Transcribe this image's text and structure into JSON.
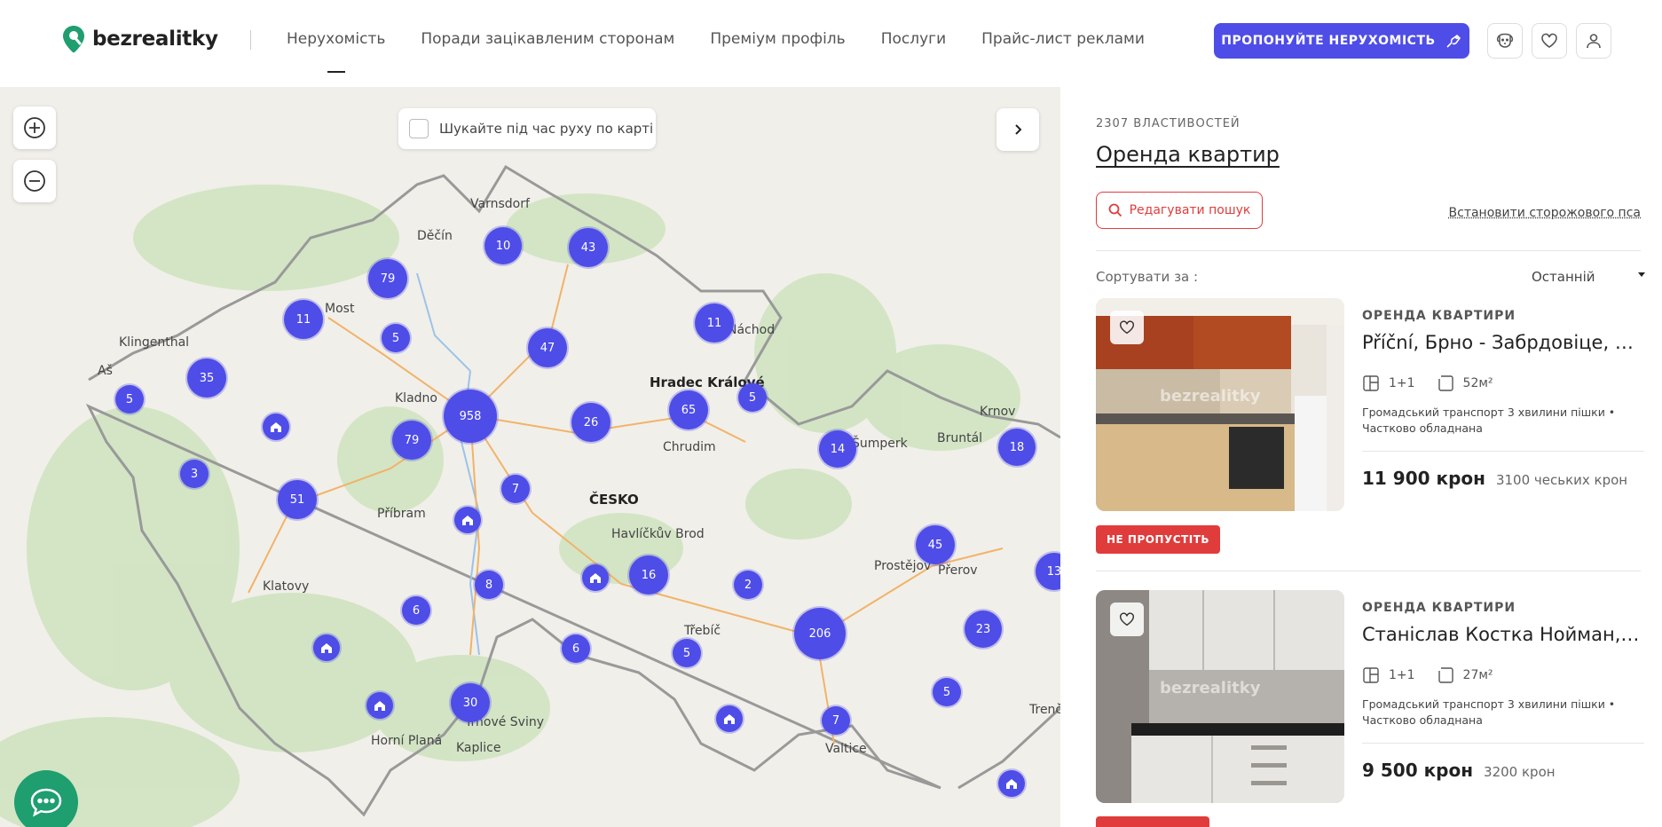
{
  "header": {
    "logo_text": "bezrealitky",
    "nav": [
      {
        "label": "Нерухомість",
        "active": true
      },
      {
        "label": "Поради зацікавленим сторонам"
      },
      {
        "label": "Преміум профіль"
      },
      {
        "label": "Послуги"
      },
      {
        "label": "Прайс-лист реклами"
      }
    ],
    "cta_label": "ПРОПОНУЙТЕ НЕРУХОМІСТЬ"
  },
  "map": {
    "search_while_moving_label": "Шукайте під час руху по карті",
    "region_label": "ČESKO",
    "cities": [
      "Varnsdorf",
      "Děčín",
      "Most",
      "Klingenthal",
      "Aš",
      "Kladno",
      "Hradec Králové",
      "Náchod",
      "Chrudim",
      "Příbram",
      "Havlíčkův Brod",
      "Klatovy",
      "Třebíč",
      "Trhové Sviny",
      "Kaplice",
      "Horní Planá",
      "Valtice",
      "Šumperk",
      "Bruntál",
      "Krnov",
      "Prostějov",
      "Přerov",
      "Trenč"
    ],
    "clusters": [
      "10",
      "43",
      "79",
      "11",
      "5",
      "47",
      "11",
      "35",
      "5",
      "958",
      "26",
      "65",
      "5",
      "79",
      "3",
      "7",
      "14",
      "18",
      "51",
      "45",
      "13",
      "8",
      "16",
      "2",
      "6",
      "6",
      "5",
      "206",
      "23",
      "30",
      "7",
      "5"
    ]
  },
  "panel": {
    "count_label": "2307 ВЛАСТИВОСТЕЙ",
    "title": "Оренда квартир",
    "edit_search_label": "Редагувати пошук",
    "watchdog_label": "Встановити сторожового пса",
    "sort_label": "Сортувати за :",
    "sort_value": "Останній",
    "listings": [
      {
        "type": "ОРЕНДА КВАРТИРИ",
        "address": "Příční, Брно - Забрдовіце, Пів...",
        "layout": "1+1",
        "area": "52м²",
        "desc_line1": "Громадський транспорт 3 хвилини пішки •",
        "desc_line2": "Частково обладнана",
        "price": "11 900 крон",
        "fees": "3100 чеських крон",
        "badge": "НЕ ПРОПУСТІТЬ",
        "watermark": "bezrealitky"
      },
      {
        "type": "ОРЕНДА КВАРТИРИ",
        "address": "Станіслав Костка Нойман, Бе...",
        "layout": "1+1",
        "area": "27м²",
        "desc_line1": "Громадський транспорт 3 хвилини пішки •",
        "desc_line2": "Частково обладнана",
        "price": "9 500 крон",
        "fees": "3200 крон",
        "watermark": "bezrealitky"
      }
    ]
  },
  "colors": {
    "accent": "#4e4de8",
    "danger": "#e03c3c",
    "chat": "#1f9e6f"
  }
}
